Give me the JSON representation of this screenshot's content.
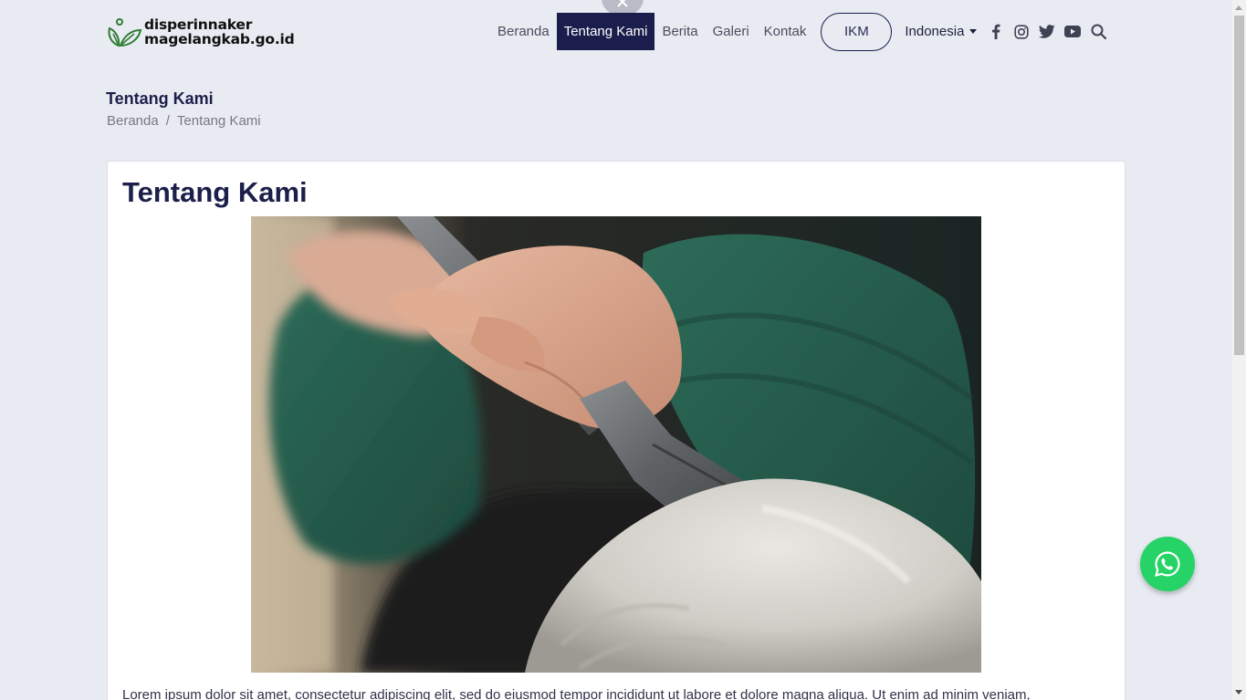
{
  "logo": {
    "line1": "disperinnaker",
    "line2": "magelangkab.go.id",
    "icon": "leaf-logo-icon"
  },
  "nav": {
    "items": [
      {
        "label": "Beranda",
        "active": false
      },
      {
        "label": "Tentang Kami",
        "active": true
      },
      {
        "label": "Berita",
        "active": false
      },
      {
        "label": "Galeri",
        "active": false
      },
      {
        "label": "Kontak",
        "active": false
      }
    ],
    "ikm_label": "IKM",
    "language": "Indonesia",
    "social_icons": [
      "facebook-icon",
      "instagram-icon",
      "twitter-icon",
      "youtube-icon"
    ],
    "search_icon": "search-icon"
  },
  "page": {
    "heading": "Tentang Kami",
    "breadcrumb": [
      "Beranda",
      "Tentang Kami"
    ]
  },
  "content": {
    "title": "Tentang Kami",
    "image_subject": "stone-carving-chisel-photo",
    "paragraph": "Lorem ipsum dolor sit amet, consectetur adipiscing elit, sed do eiusmod tempor incididunt ut labore et dolore magna aliqua. Ut enim ad minim veniam,"
  },
  "floating": {
    "whatsapp_icon": "whatsapp-icon",
    "close_icon": "close-icon"
  },
  "colors": {
    "primary": "#1b1e4d",
    "background": "#e9ebf3",
    "whatsapp": "#25d366"
  }
}
